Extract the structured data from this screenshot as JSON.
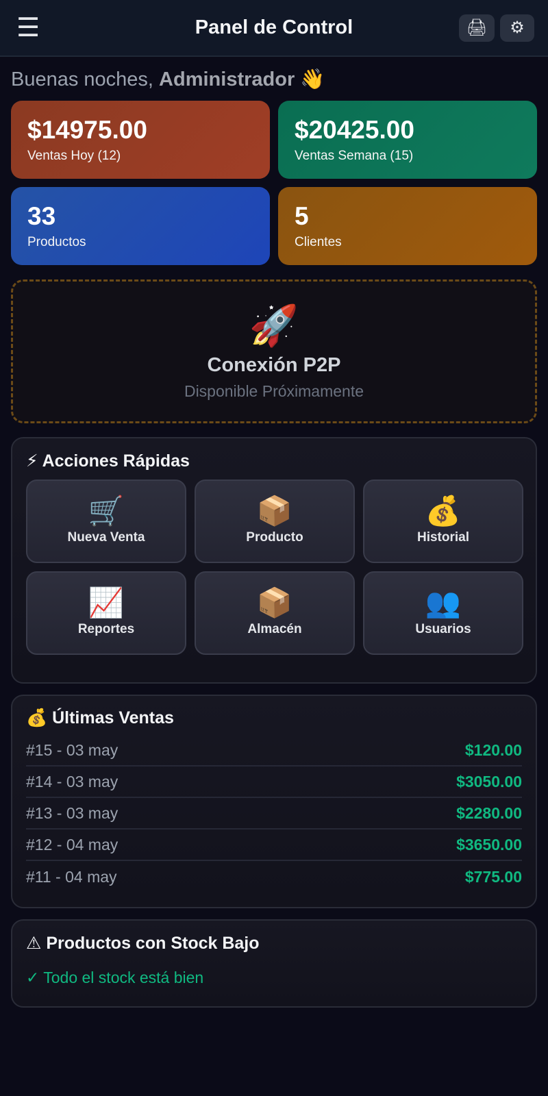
{
  "header": {
    "title": "Panel de Control",
    "menu_icon": "☰",
    "print_icon": "🖨",
    "settings_icon": "⚙"
  },
  "greeting": {
    "prefix": "Buenas noches,",
    "name": "Administrador",
    "emoji": "👋"
  },
  "stats": [
    {
      "value": "$14975.00",
      "label": "Ventas Hoy (12)",
      "color": "#98402a"
    },
    {
      "value": "$20425.00",
      "label": "Ventas Semana (15)",
      "color": "#0d7457"
    },
    {
      "value": "33",
      "label": "Productos",
      "color": "#2250ae"
    },
    {
      "value": "5",
      "label": "Clientes",
      "color": "#95570e"
    }
  ],
  "p2p": {
    "icon": "🚀",
    "title": "Conexión P2P",
    "subtitle": "Disponible Próximamente"
  },
  "quick_actions": {
    "title": "⚡ Acciones Rápidas",
    "items": [
      {
        "icon": "🛒",
        "label": "Nueva Venta"
      },
      {
        "icon": "📦",
        "label": "Producto"
      },
      {
        "icon": "💰",
        "label": "Historial"
      },
      {
        "icon": "📈",
        "label": "Reportes"
      },
      {
        "icon": "📦",
        "label": "Almacén"
      },
      {
        "icon": "👥",
        "label": "Usuarios"
      }
    ]
  },
  "recent_sales": {
    "title": "💰 Últimas Ventas",
    "rows": [
      {
        "id": "#15 - 03 may",
        "amount": "$120.00"
      },
      {
        "id": "#14 - 03 may",
        "amount": "$3050.00"
      },
      {
        "id": "#13 - 03 may",
        "amount": "$2280.00"
      },
      {
        "id": "#12 - 04 may",
        "amount": "$3650.00"
      },
      {
        "id": "#11 - 04 may",
        "amount": "$775.00"
      }
    ]
  },
  "low_stock": {
    "title": "⚠ Productos con Stock Bajo",
    "message": "✓ Todo el stock está bien"
  },
  "colors": {
    "accent_green": "#10b981",
    "background": "#0b0b18"
  }
}
